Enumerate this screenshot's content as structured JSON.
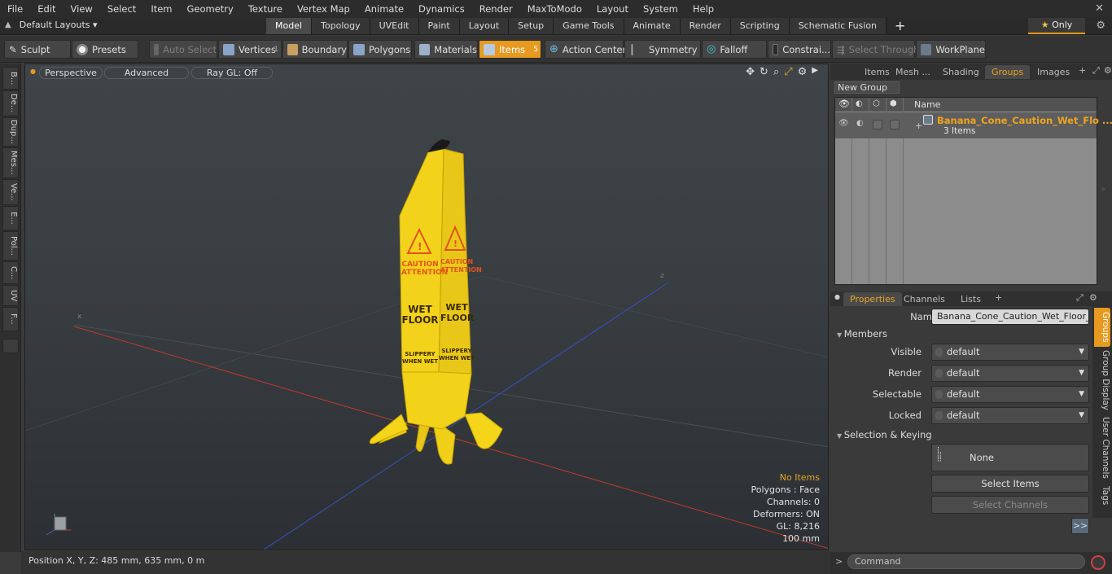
{
  "menu": [
    "File",
    "Edit",
    "View",
    "Select",
    "Item",
    "Geometry",
    "Texture",
    "Vertex Map",
    "Animate",
    "Dynamics",
    "Render",
    "MaxToModo",
    "Layout",
    "System",
    "Help"
  ],
  "layout": {
    "default_layouts": "Default Layouts",
    "tabs": [
      "Model",
      "Topology",
      "UVEdit",
      "Paint",
      "Layout",
      "Setup",
      "Game Tools",
      "Animate",
      "Render",
      "Scripting",
      "Schematic Fusion"
    ],
    "active_tab": "Model",
    "only_label": "Only"
  },
  "toolbar": {
    "sculpt": "Sculpt",
    "presets": "Presets",
    "auto_select": "Auto Select",
    "vertices": "Vertices",
    "vertices_count": "1",
    "boundary": "Boundary",
    "polygons": "Polygons",
    "materials": "Materials",
    "items": "Items",
    "items_count": "5",
    "action_center": "Action Center",
    "symmetry": "Symmetry",
    "falloff": "Falloff",
    "constraints": "Constrai...",
    "select_through": "Select Through",
    "workplane": "WorkPlane"
  },
  "left_strip": [
    "B...",
    "De...",
    "Dup...",
    "Mes...",
    "Ve...",
    "E...",
    "Pol...",
    "C...",
    "UV",
    "F..."
  ],
  "viewport": {
    "perspective": "Perspective",
    "advanced": "Advanced",
    "raygl": "Ray GL: Off",
    "cone_text": {
      "caution": "CAUTION",
      "attention": "ATTENTION",
      "wet": "WET",
      "floor": "FLOOR",
      "slippery": "SLIPPERY",
      "when_wet": "WHEN WET"
    },
    "stats": {
      "no_items": "No Items",
      "polygons": "Polygons : Face",
      "channels": "Channels: 0",
      "deformers": "Deformers: ON",
      "gl": "GL: 8,216",
      "scale": "100 mm"
    }
  },
  "status": {
    "position": "Position X, Y, Z:   485 mm, 635 mm, 0 m"
  },
  "right_panel": {
    "tabs": [
      "Items",
      "Mesh ...",
      "Shading",
      "Groups",
      "Images"
    ],
    "active_tab": "Groups",
    "new_group": "New Group",
    "name_header": "Name",
    "group_name": "Banana_Cone_Caution_Wet_Flo ...",
    "group_count": "3 Items",
    "prop_tabs": [
      "Properties",
      "Channels",
      "Lists"
    ],
    "name_label": "Name",
    "name_value": "Banana_Cone_Caution_Wet_Floor_Sig",
    "members": "Members",
    "fields": [
      {
        "label": "Visible",
        "value": "default"
      },
      {
        "label": "Render",
        "value": "default"
      },
      {
        "label": "Selectable",
        "value": "default"
      },
      {
        "label": "Locked",
        "value": "default"
      }
    ],
    "selection_keying": "Selection & Keying",
    "none": "None",
    "select_items": "Select Items",
    "select_channels": "Select Channels",
    "more": ">>",
    "vertical_tabs": [
      "Groups",
      "Group Display",
      "User Channels",
      "Tags"
    ],
    "command_placeholder": "Command"
  },
  "colors": {
    "accent": "#e69a1f",
    "banana": "#f2d11a",
    "warning_text": "#e0541c"
  }
}
